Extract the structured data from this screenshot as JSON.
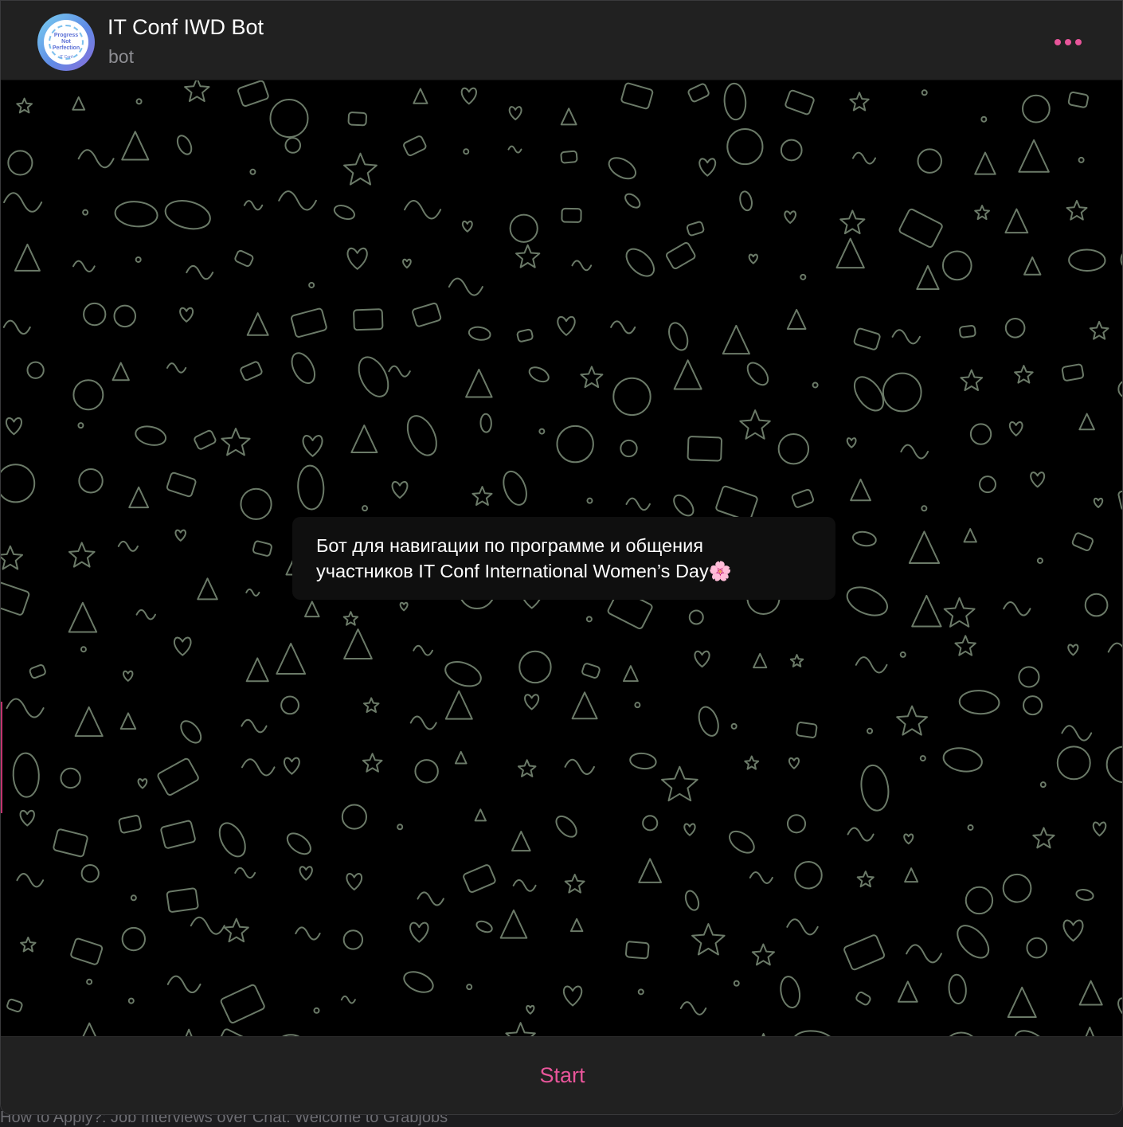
{
  "header": {
    "title": "IT Conf IWD Bot",
    "subtitle": "bot",
    "avatar_line1": "Progress",
    "avatar_line2": "Not",
    "avatar_line3": "Perfection",
    "avatar_caption": "IT Conf"
  },
  "message": {
    "text": "Бот для навигации по программе и общения\nучастников IT Conf International Women’s Day🌸"
  },
  "footer": {
    "start_label": "Start"
  },
  "background_window": {
    "partial_text": "How to Apply?: Job Interviews over Chat: Welcome to Grabjobs"
  },
  "colors": {
    "accent": "#e8559a",
    "header_bg": "#212121",
    "chat_bg": "#000000",
    "doodle": "#6b7a68"
  },
  "icons": {
    "menu": "more-dots-icon",
    "wallpaper": "doodle-pattern"
  }
}
